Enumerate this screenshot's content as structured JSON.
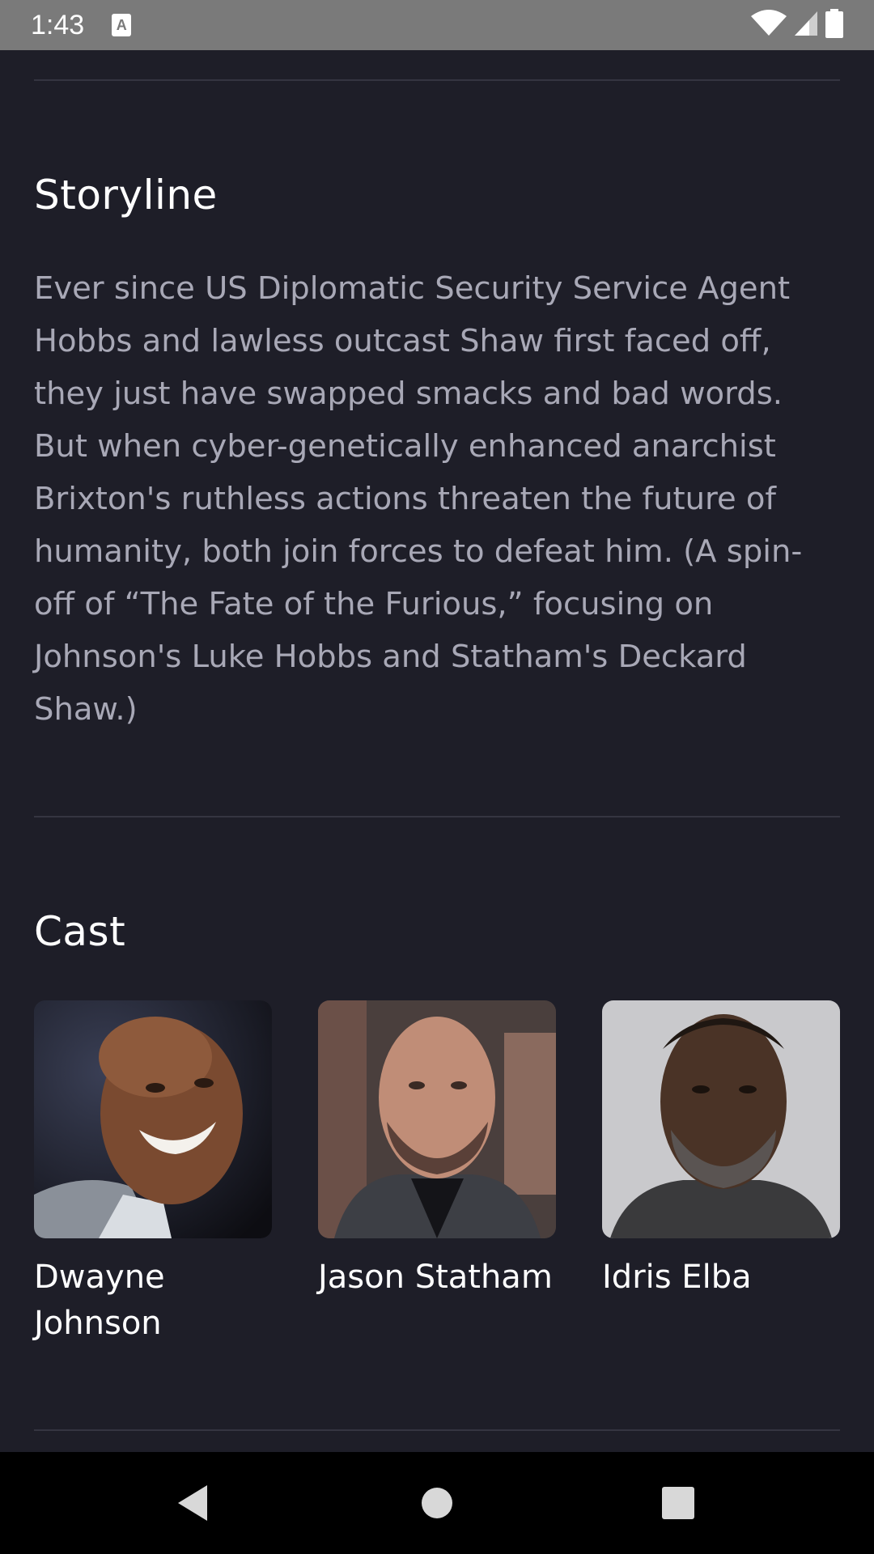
{
  "status_bar": {
    "time": "1:43",
    "notification_icon": "text-a-icon",
    "notification_letter": "A",
    "icons": [
      "wifi-icon",
      "signal-icon",
      "battery-icon"
    ]
  },
  "storyline": {
    "title": "Storyline",
    "text": "Ever since US Diplomatic Security Service Agent Hobbs and lawless outcast Shaw first faced off, they just have swapped smacks and bad words. But when cyber-genetically enhanced anarchist Brixton's ruthless actions threaten the future of humanity, both join forces to defeat him. (A spin-off of “The Fate of the Furious,” focusing on Johnson's Luke Hobbs and Statham's Deckard Shaw.)"
  },
  "cast": {
    "title": "Cast",
    "members": [
      {
        "name": "Dwayne Johnson",
        "photo": "portrait-dwayne-johnson"
      },
      {
        "name": "Jason Statham",
        "photo": "portrait-jason-statham"
      },
      {
        "name": "Idris Elba",
        "photo": "portrait-idris-elba"
      }
    ]
  },
  "nav_bar": {
    "buttons": [
      "back-icon",
      "home-icon",
      "recents-icon"
    ]
  },
  "colors": {
    "background": "#1e1e28",
    "status_bar": "#7a7a7a",
    "divider": "#353541",
    "body_text": "#a8a8b6",
    "heading_text": "#ffffff"
  }
}
